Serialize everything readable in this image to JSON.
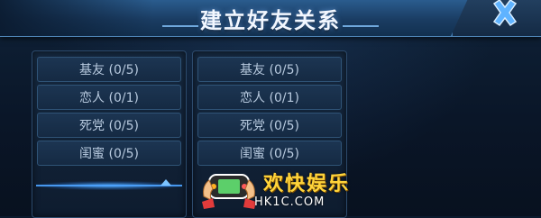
{
  "window": {
    "title": "建立好友关系"
  },
  "close": {
    "icon": "close-x-icon"
  },
  "left_column": {
    "items": [
      "基友 (0/5)",
      "恋人 (0/1)",
      "死党 (0/5)",
      "闺蜜 (0/5)"
    ]
  },
  "right_column": {
    "items": [
      "基友 (0/5)",
      "恋人 (0/1)",
      "死党 (0/5)",
      "闺蜜 (0/5)"
    ]
  },
  "scroll": {
    "icon": "chevron-up-icon"
  },
  "watermark": {
    "text": "欢快娱乐",
    "url": "HK1C.COM",
    "logo": "handheld-game-logo"
  },
  "colors": {
    "accent": "#4da3ff",
    "title_bar": "#1a3c62",
    "watermark": "#ffd43a"
  }
}
